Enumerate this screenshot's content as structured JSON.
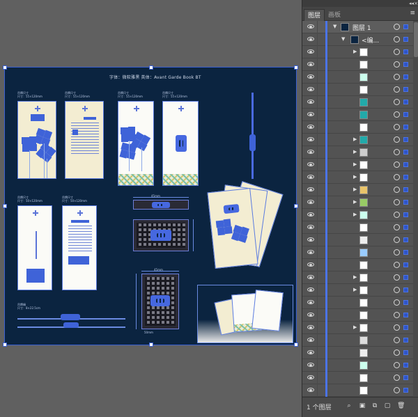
{
  "artboard": {
    "title": "字体：微软雅黑  英体：Avant Garde Book BT",
    "specs": {
      "a": "吊牌尺寸\n尺寸：55×120mm",
      "b": "吊牌尺寸\n尺寸：55×120mm",
      "c": "吊牌尺寸\n尺寸：55×120mm",
      "d": "吊牌尺寸\n尺寸：55×120mm",
      "e": "吊牌尺寸\n尺寸：50×120mm",
      "f": "吊牌尺寸\n尺寸：50×120mm",
      "g": "吊牌绳\n尺寸：8×22.5cm",
      "dim1": "45mm",
      "dim2": "45mm",
      "dim3": "50mm"
    }
  },
  "panel": {
    "tabs": [
      "图层",
      "画板"
    ],
    "layer_name": "图层 1",
    "group_name": "<编...",
    "layer_count": "1 个图层",
    "colors": {
      "accent": "#4b74e6",
      "panel": "#535353"
    },
    "icons": [
      "eye-icon",
      "target-icon",
      "search-icon",
      "make-clip-icon",
      "new-sublayer-icon",
      "new-layer-icon",
      "trash-icon"
    ]
  }
}
